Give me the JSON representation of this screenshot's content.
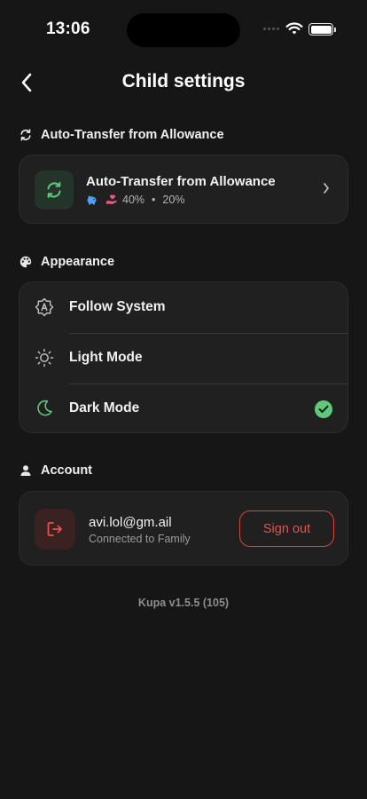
{
  "status_bar": {
    "time": "13:06"
  },
  "header": {
    "title": "Child settings"
  },
  "auto_transfer": {
    "section_title": "Auto-Transfer from Allowance",
    "item_title": "Auto-Transfer from Allowance",
    "savings_pct": "40%",
    "separator": "•",
    "donate_pct": "20%"
  },
  "appearance": {
    "section_title": "Appearance",
    "options": [
      {
        "label": "Follow System"
      },
      {
        "label": "Light Mode"
      },
      {
        "label": "Dark Mode"
      }
    ],
    "selected": "Dark Mode"
  },
  "account": {
    "section_title": "Account",
    "email": "avi.lol@gm.ail",
    "status": "Connected to Family",
    "sign_out_label": "Sign out"
  },
  "footer": {
    "version": "Kupa v1.5.5 (105)"
  },
  "colors": {
    "background": "#161616",
    "card": "#202020",
    "accent_green": "#5fc87a",
    "danger_red": "#e4544c"
  }
}
